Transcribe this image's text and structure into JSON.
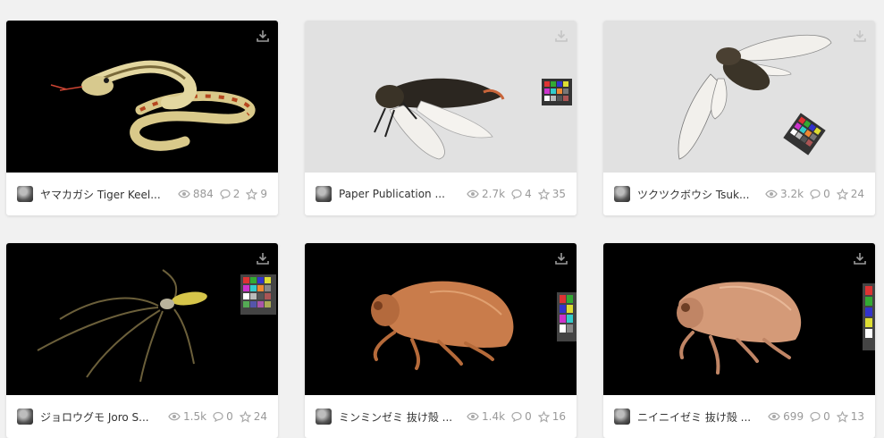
{
  "icons": {
    "download": "download-icon",
    "views": "eye-icon",
    "comments": "comment-icon",
    "likes": "star-icon"
  },
  "colors": {
    "background": "#f1f1f1",
    "card": "#ffffff",
    "meta_text": "#999999",
    "title_text": "#333333"
  },
  "cards": [
    {
      "title": "ヤマカガシ Tiger Keel...",
      "views": "884",
      "comments": "2",
      "likes": "9",
      "bg": "black"
    },
    {
      "title": "Paper Publication ...",
      "views": "2.7k",
      "comments": "4",
      "likes": "35",
      "bg": "gray"
    },
    {
      "title": "ツクツクボウシ Tsuk...",
      "views": "3.2k",
      "comments": "0",
      "likes": "24",
      "bg": "gray"
    },
    {
      "title": "ジョロウグモ Joro S...",
      "views": "1.5k",
      "comments": "0",
      "likes": "24",
      "bg": "black"
    },
    {
      "title": "ミンミンゼミ 抜け殻 ...",
      "views": "1.4k",
      "comments": "0",
      "likes": "16",
      "bg": "black"
    },
    {
      "title": "ニイニイゼミ 抜け殻 ...",
      "views": "699",
      "comments": "0",
      "likes": "13",
      "bg": "black"
    }
  ]
}
